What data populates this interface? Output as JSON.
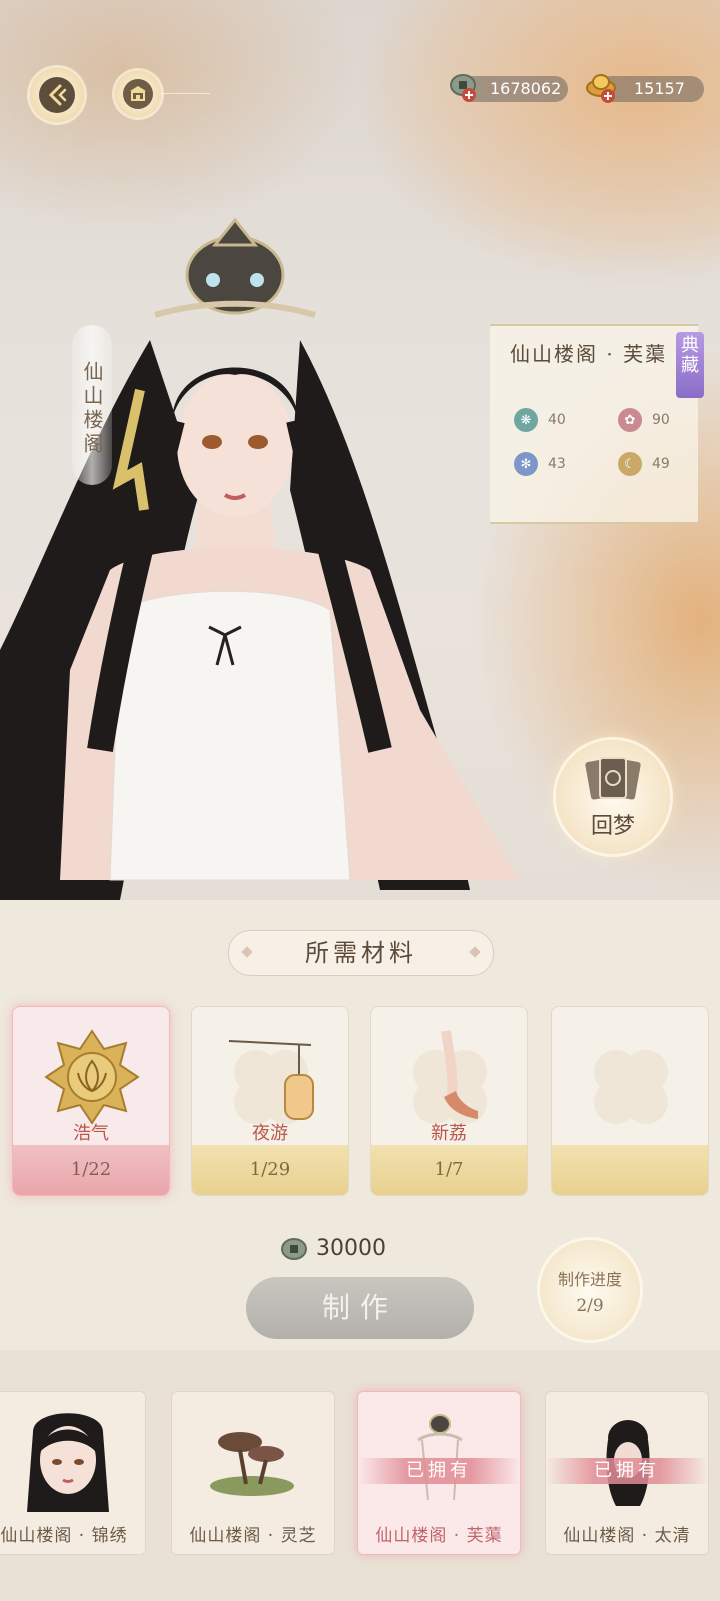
{
  "header": {
    "back_icon": "back-arrow-icon",
    "shop_icon": "pavilion-icon",
    "currencies": [
      {
        "icon": "copper-coin-icon",
        "value": "1678062"
      },
      {
        "icon": "gold-ingot-icon",
        "value": "15157"
      }
    ]
  },
  "outfit": {
    "series_name": "仙山楼阁",
    "full_name": "仙山楼阁 · 芙蕖",
    "tag": "典藏",
    "stats": [
      {
        "icon": "pattern-icon",
        "value": "40",
        "color": "#6fa7a0"
      },
      {
        "icon": "lotus-icon",
        "value": "90",
        "color": "#c98a92"
      },
      {
        "icon": "snowflake-icon",
        "value": "43",
        "color": "#7d98c8"
      },
      {
        "icon": "moon-icon",
        "value": "49",
        "color": "#c9a868"
      }
    ]
  },
  "dream_button": {
    "label": "回梦",
    "icon": "tarot-cards-icon"
  },
  "materials": {
    "title": "所需材料",
    "items": [
      {
        "name": "浩气",
        "count": "1/22",
        "style": "pink",
        "icon": "golden-lotus-icon"
      },
      {
        "name": "夜游",
        "count": "1/29",
        "style": "gold",
        "icon": "lantern-icon"
      },
      {
        "name": "新荔",
        "count": "1/7",
        "style": "gold",
        "icon": "shoe-icon"
      },
      {
        "name": "",
        "count": "",
        "style": "gold",
        "icon": ""
      }
    ]
  },
  "craft": {
    "cost": "30000",
    "cost_icon": "copper-coin-icon",
    "button_label": "制作",
    "progress_label": "制作进度",
    "progress_value": "2/9"
  },
  "bottom_items": [
    {
      "name": "仙山楼阁 · 锦绣",
      "owned": "",
      "icon": "portrait-icon"
    },
    {
      "name": "仙山楼阁 · 灵芝",
      "owned": "",
      "icon": "lingzhi-icon"
    },
    {
      "name": "仙山楼阁 · 芙蕖",
      "owned": "已拥有",
      "icon": "crown-icon",
      "selected": true
    },
    {
      "name": "仙山楼阁 · 太清",
      "owned": "已拥有",
      "icon": "hairstyle-icon"
    }
  ]
}
